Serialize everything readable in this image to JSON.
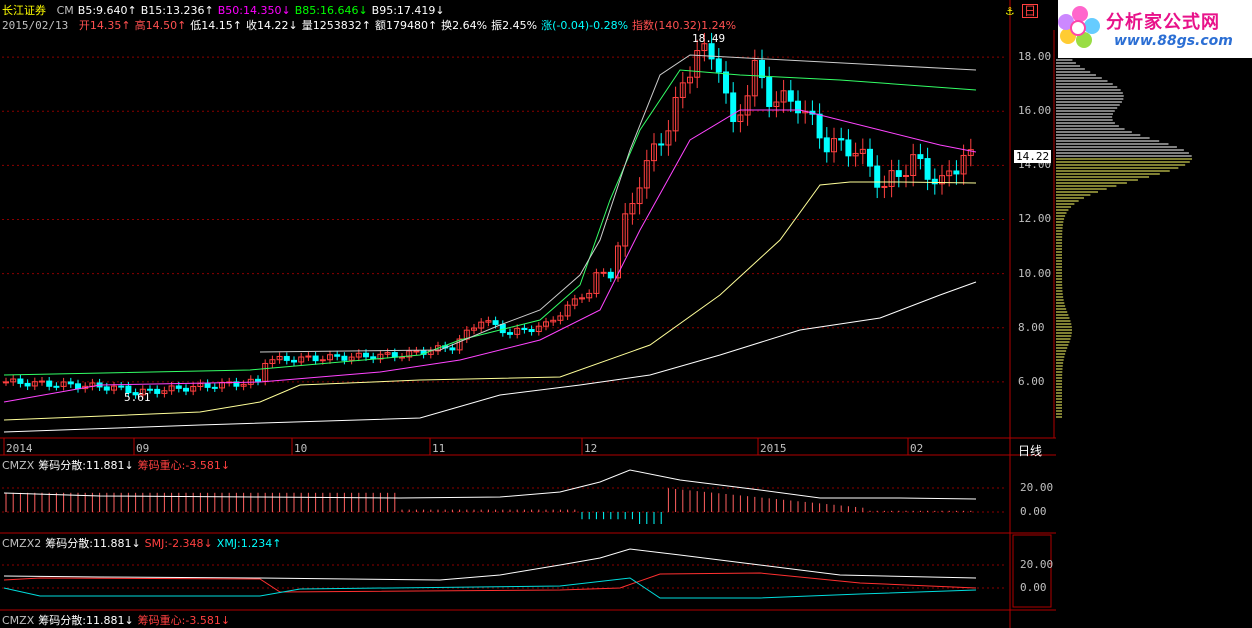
{
  "header": {
    "stock_name": "长江证券",
    "ind1": [
      {
        "text": "CM",
        "color": "#c0c0c0"
      },
      {
        "text": "B5:9.640↑",
        "color": "#ffffff"
      },
      {
        "text": "B15:13.236↑",
        "color": "#ffffff"
      },
      {
        "text": "B50:14.350↓",
        "color": "#ff00ff"
      },
      {
        "text": "B85:16.646↓",
        "color": "#00ff00"
      },
      {
        "text": "B95:17.419↓",
        "color": "#ffffff"
      }
    ],
    "date": "2015/02/13",
    "quote": [
      {
        "text": "开14.35↑",
        "color": "#ff5050"
      },
      {
        "text": "高14.50↑",
        "color": "#ff5050"
      },
      {
        "text": "低14.15↑",
        "color": "#ffffff"
      },
      {
        "text": "收14.22↓",
        "color": "#ffffff"
      },
      {
        "text": "量1253832↑",
        "color": "#ffffff"
      },
      {
        "text": "额179480↑",
        "color": "#ffffff"
      },
      {
        "text": "换2.64%",
        "color": "#ffffff"
      },
      {
        "text": "振2.45%",
        "color": "#ffffff"
      },
      {
        "text": "涨(-0.04)-0.28%",
        "color": "#00ffff"
      },
      {
        "text": "指数(140.32)1.24%",
        "color": "#ff5050"
      }
    ]
  },
  "logo": {
    "text": "分析家公式网",
    "url": "www.88gs.com"
  },
  "price_label": "14.22",
  "period_label": "日线",
  "sub1": [
    {
      "text": "CMZX",
      "color": "#c0c0c0"
    },
    {
      "text": "筹码分散:11.881↓",
      "color": "#ffffff"
    },
    {
      "text": "筹码重心:-3.581↓",
      "color": "#ff4040"
    }
  ],
  "sub2": [
    {
      "text": "CMZX2",
      "color": "#c0c0c0"
    },
    {
      "text": "筹码分散:11.881↓",
      "color": "#ffffff"
    },
    {
      "text": "SMJ:-2.348↓",
      "color": "#ff4040"
    },
    {
      "text": "XMJ:1.234↑",
      "color": "#00ffff"
    }
  ],
  "sub3": [
    {
      "text": "CMZX",
      "color": "#c0c0c0"
    },
    {
      "text": "筹码分散:11.881↓",
      "color": "#ffffff"
    },
    {
      "text": "筹码重心:-3.581↓",
      "color": "#ff4040"
    }
  ],
  "colors": {
    "up": "#ff4040",
    "down": "#00ffff",
    "bg": "#000000",
    "grid": "#8b0000"
  },
  "chart_data": {
    "type": "candlestick",
    "ylim": [
      4.0,
      19.0
    ],
    "yticks": [
      "6.00",
      "8.00",
      "10.00",
      "12.00",
      "14.00",
      "16.00",
      "18.00"
    ],
    "xticks": [
      "2014",
      "09",
      "10",
      "11",
      "12",
      "2015",
      "02"
    ],
    "annotations": [
      {
        "text": "18.49"
      },
      {
        "text": "5.61"
      }
    ],
    "ohlc_summary": {
      "start_close": 6.0,
      "low": 5.61,
      "high": 18.49,
      "last_close": 14.22
    },
    "sub1": {
      "yticks": [
        "20.00",
        "0.00"
      ]
    },
    "sub2": {
      "yticks": [
        "20.00",
        "0.00"
      ]
    }
  }
}
